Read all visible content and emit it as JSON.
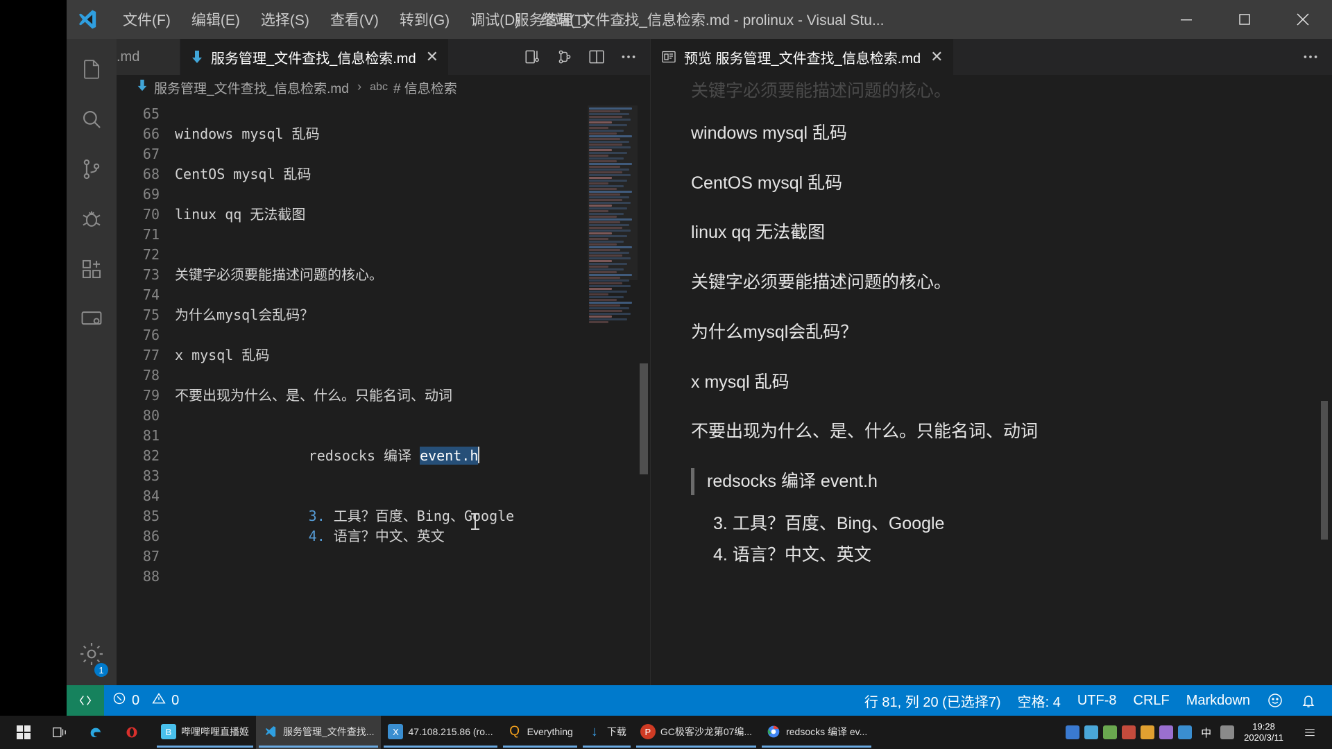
{
  "window": {
    "title": "服务管理_文件查找_信息检索.md - prolinux - Visual Stu...",
    "minimize": "—",
    "maximize": "▢",
    "close": "✕"
  },
  "menubar": {
    "items": [
      {
        "label": "文件(F)"
      },
      {
        "label": "编辑(E)"
      },
      {
        "label": "选择(S)"
      },
      {
        "label": "查看(V)"
      },
      {
        "label": "转到(G)"
      },
      {
        "label": "调试(D)"
      },
      {
        "label": "终端(T)"
      },
      {
        "label": "…"
      }
    ]
  },
  "activitybar": {
    "items": [
      {
        "name": "explorer",
        "glyph": "files-icon"
      },
      {
        "name": "search",
        "glyph": "search-icon"
      },
      {
        "name": "source-control",
        "glyph": "branch-icon"
      },
      {
        "name": "debug",
        "glyph": "debug-icon"
      },
      {
        "name": "extensions",
        "glyph": "extensions-icon"
      },
      {
        "name": "remote",
        "glyph": "remote-icon"
      }
    ],
    "settings_badge": "1"
  },
  "editor": {
    "tabs": [
      {
        "label": ".md",
        "active": false,
        "partial": true
      },
      {
        "label": "服务管理_文件查找_信息检索.md",
        "active": true,
        "close": "✕"
      }
    ],
    "breadcrumb": {
      "file": "服务管理_文件查找_信息检索.md",
      "separator": "›",
      "symbol_kind": "abc",
      "symbol": "# 信息检索"
    },
    "lines": [
      {
        "num": "65",
        "text": ""
      },
      {
        "num": "66",
        "text": "windows mysql 乱码"
      },
      {
        "num": "67",
        "text": ""
      },
      {
        "num": "68",
        "text": "CentOS mysql 乱码"
      },
      {
        "num": "69",
        "text": ""
      },
      {
        "num": "70",
        "text": "linux qq 无法截图"
      },
      {
        "num": "71",
        "text": ""
      },
      {
        "num": "72",
        "text": ""
      },
      {
        "num": "73",
        "text": "关键字必须要能描述问题的核心。"
      },
      {
        "num": "74",
        "text": ""
      },
      {
        "num": "75",
        "text": "为什么mysql会乱码？"
      },
      {
        "num": "76",
        "text": ""
      },
      {
        "num": "77",
        "text": "x mysql 乱码"
      },
      {
        "num": "78",
        "text": ""
      },
      {
        "num": "79",
        "text": "不要出现为什么、是、什么。只能名词、动词"
      },
      {
        "num": "80",
        "text": ""
      },
      {
        "num": "81",
        "text_prefix": "redsocks 编译 ",
        "selected": "event.h",
        "text": "redsocks 编译 event.h"
      },
      {
        "num": "82",
        "text": ""
      },
      {
        "num": "83",
        "text": ""
      },
      {
        "num": "84",
        "marker": "3.",
        "text": " 工具？百度、Bing、Google"
      },
      {
        "num": "85",
        "marker": "4.",
        "text": " 语言？中文、英文"
      },
      {
        "num": "86",
        "text": ""
      },
      {
        "num": "87",
        "text": ""
      },
      {
        "num": "88",
        "text": ""
      }
    ]
  },
  "preview": {
    "tab_label": "预览 服务管理_文件查找_信息检索.md",
    "tab_close": "✕",
    "more": "…",
    "paragraphs": [
      {
        "text": "关键字必须要能描述问题的核心。",
        "faded": true
      },
      {
        "text": "windows mysql 乱码"
      },
      {
        "text": "CentOS mysql 乱码"
      },
      {
        "text": "linux qq 无法截图"
      },
      {
        "text": "关键字必须要能描述问题的核心。"
      },
      {
        "text": "为什么mysql会乱码？"
      },
      {
        "text": "x mysql 乱码"
      },
      {
        "text": "不要出现为什么、是、什么。只能名词、动词"
      }
    ],
    "quote": "redsocks 编译 event.h",
    "list": [
      {
        "marker": "3.",
        "text": "工具？百度、Bing、Google"
      },
      {
        "marker": "4.",
        "text": "语言？中文、英文"
      }
    ]
  },
  "statusbar": {
    "remote": "",
    "errors": "0",
    "warnings": "0",
    "cursor": "行 81, 列 20 (已选择7)",
    "indent": "空格: 4",
    "encoding": "UTF-8",
    "eol": "CRLF",
    "language": "Markdown",
    "feedback": "☺",
    "bell": "🔔"
  },
  "taskbar": {
    "apps": [
      {
        "label": "哔哩哔哩直播姬",
        "color": "#49c0ec",
        "initial": "B",
        "active": false
      },
      {
        "label": "服务管理_文件查找...",
        "color": "#2d7fd3",
        "initial": "V",
        "active": true
      },
      {
        "label": "47.108.215.86 (ro...",
        "color": "#3a8ed0",
        "initial": "X",
        "active": false
      },
      {
        "label": "Everything",
        "color": "#f3a01c",
        "initial": "Q",
        "active": false
      },
      {
        "label": "下载",
        "color": "#3aa0e8",
        "initial": "↓",
        "active": false
      },
      {
        "label": "GC极客沙龙第07编...",
        "color": "#cf3b24",
        "initial": "P",
        "active": false
      },
      {
        "label": "redsocks 编译 ev...",
        "color": "#4285f4",
        "initial": "C",
        "active": false
      }
    ],
    "ime": "中",
    "clock_time": "19:28",
    "clock_date": "2020/3/11"
  }
}
